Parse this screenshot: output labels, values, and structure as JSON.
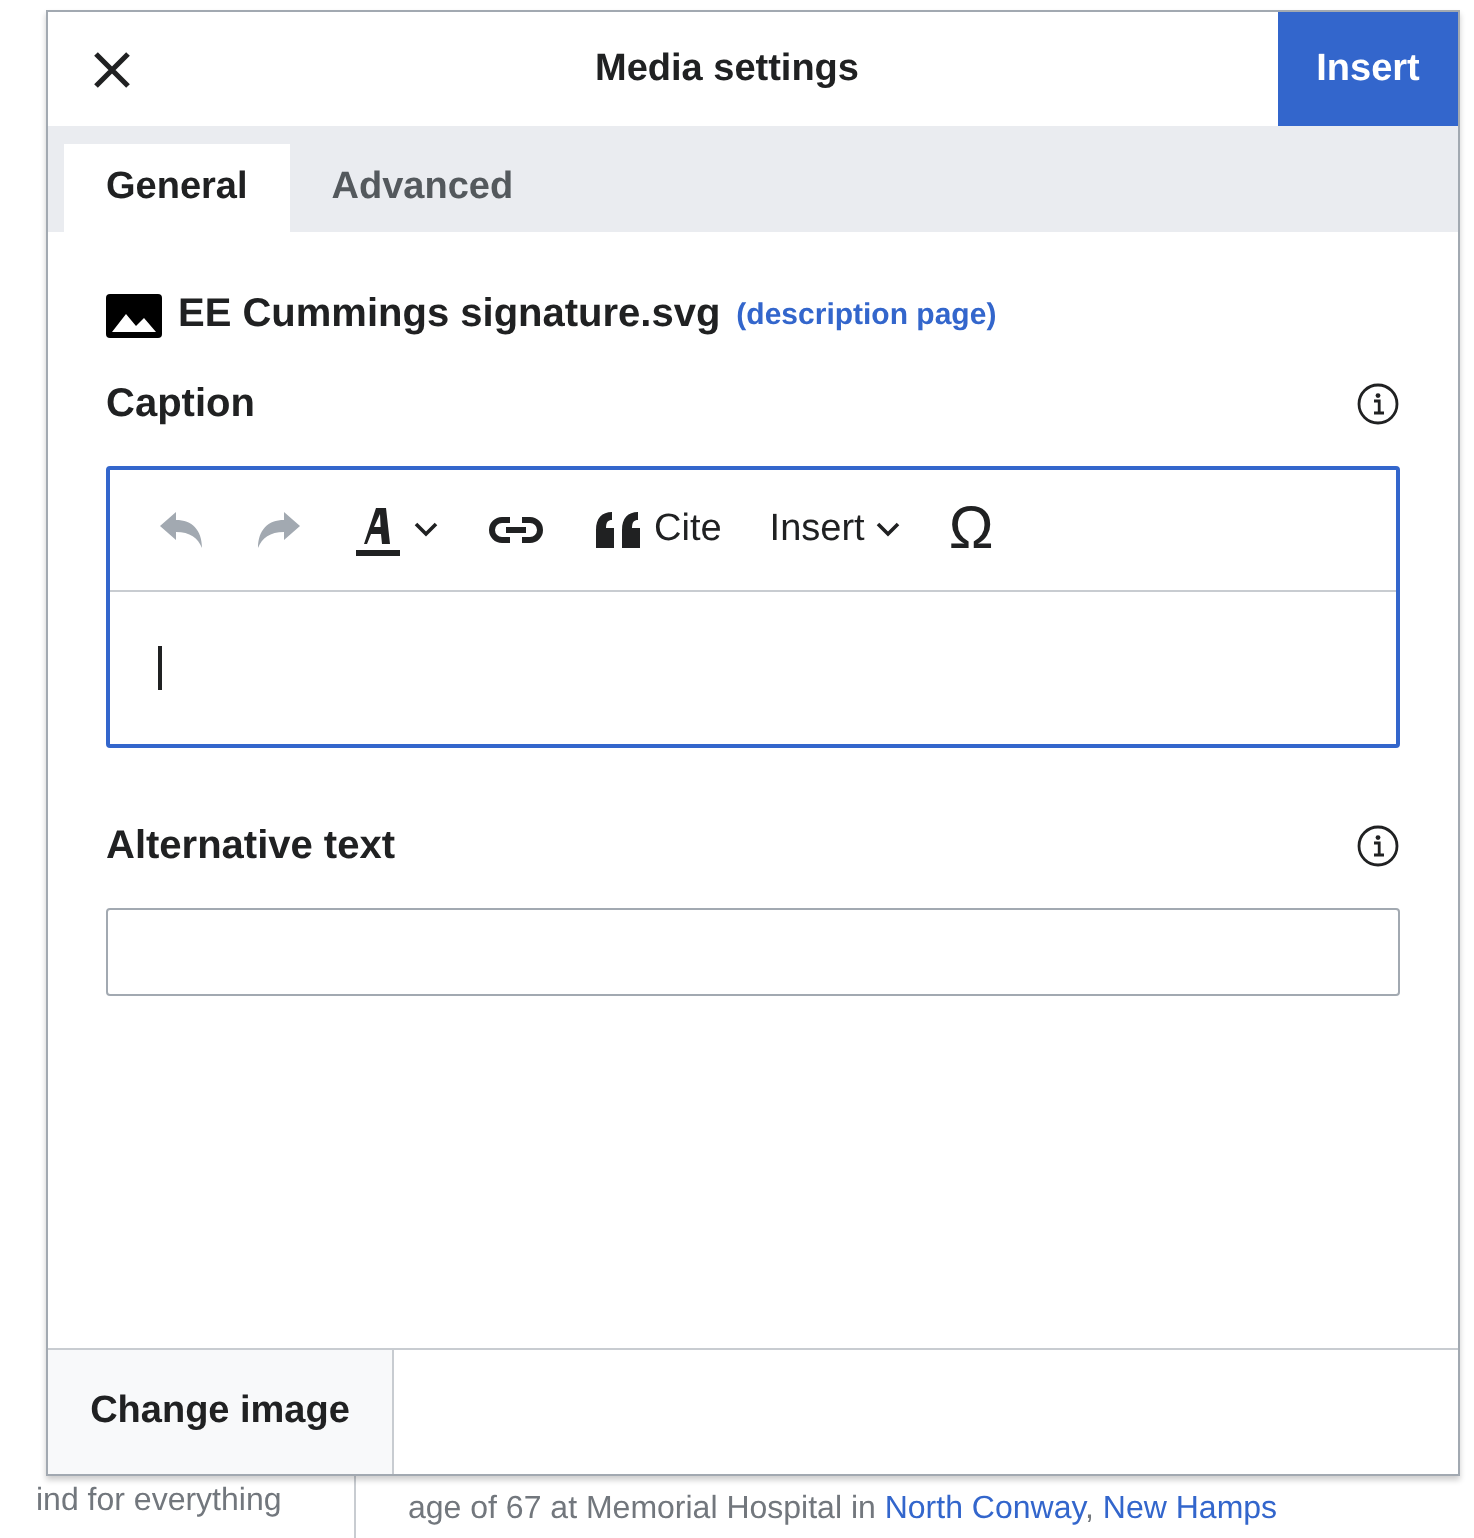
{
  "background_page": {
    "left_line": "ind for everything",
    "right_line": [
      {
        "text": "age of 67 at Memorial Hospital in ",
        "link": false
      },
      {
        "text": "North Conway",
        "link": true
      },
      {
        "text": ", ",
        "link": false
      },
      {
        "text": "New Hamps",
        "link": true
      }
    ]
  },
  "dialog": {
    "title": "Media settings",
    "primary_action": "Insert",
    "tabs": [
      {
        "label": "General",
        "selected": true
      },
      {
        "label": "Advanced",
        "selected": false
      }
    ],
    "file": {
      "name": "EE Cummings signature.svg",
      "link": "(description page)"
    },
    "caption": {
      "label": "Caption",
      "focused": true,
      "toolbar": [
        {
          "kind": "undo",
          "disabled": true
        },
        {
          "kind": "redo",
          "disabled": true
        },
        {
          "kind": "style",
          "disabled": false
        },
        {
          "kind": "link",
          "disabled": false
        },
        {
          "kind": "cite",
          "label": "Cite",
          "disabled": false
        },
        {
          "kind": "insert",
          "label": "Insert",
          "disabled": false
        },
        {
          "kind": "special",
          "label": "Ω",
          "disabled": false
        }
      ]
    },
    "alt_text": {
      "label": "Alternative text",
      "focused": false
    },
    "footer_button": "Change image"
  }
}
